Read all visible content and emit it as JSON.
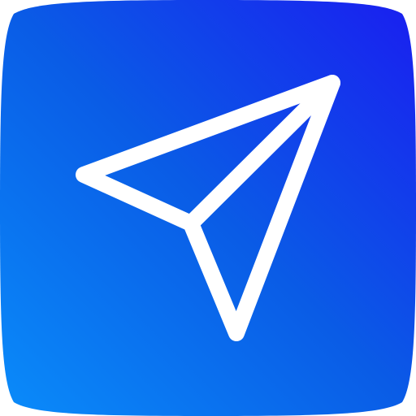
{
  "app_icon": {
    "glyph": "paper-plane-send-icon",
    "style": "outline",
    "colors": {
      "gradient_top_right": "#1a1ef0",
      "gradient_mid": "#0a5ce6",
      "gradient_bottom_left": "#0a8cfa",
      "glyph_stroke": "#ffffff",
      "page_background": "#ffffff"
    }
  }
}
